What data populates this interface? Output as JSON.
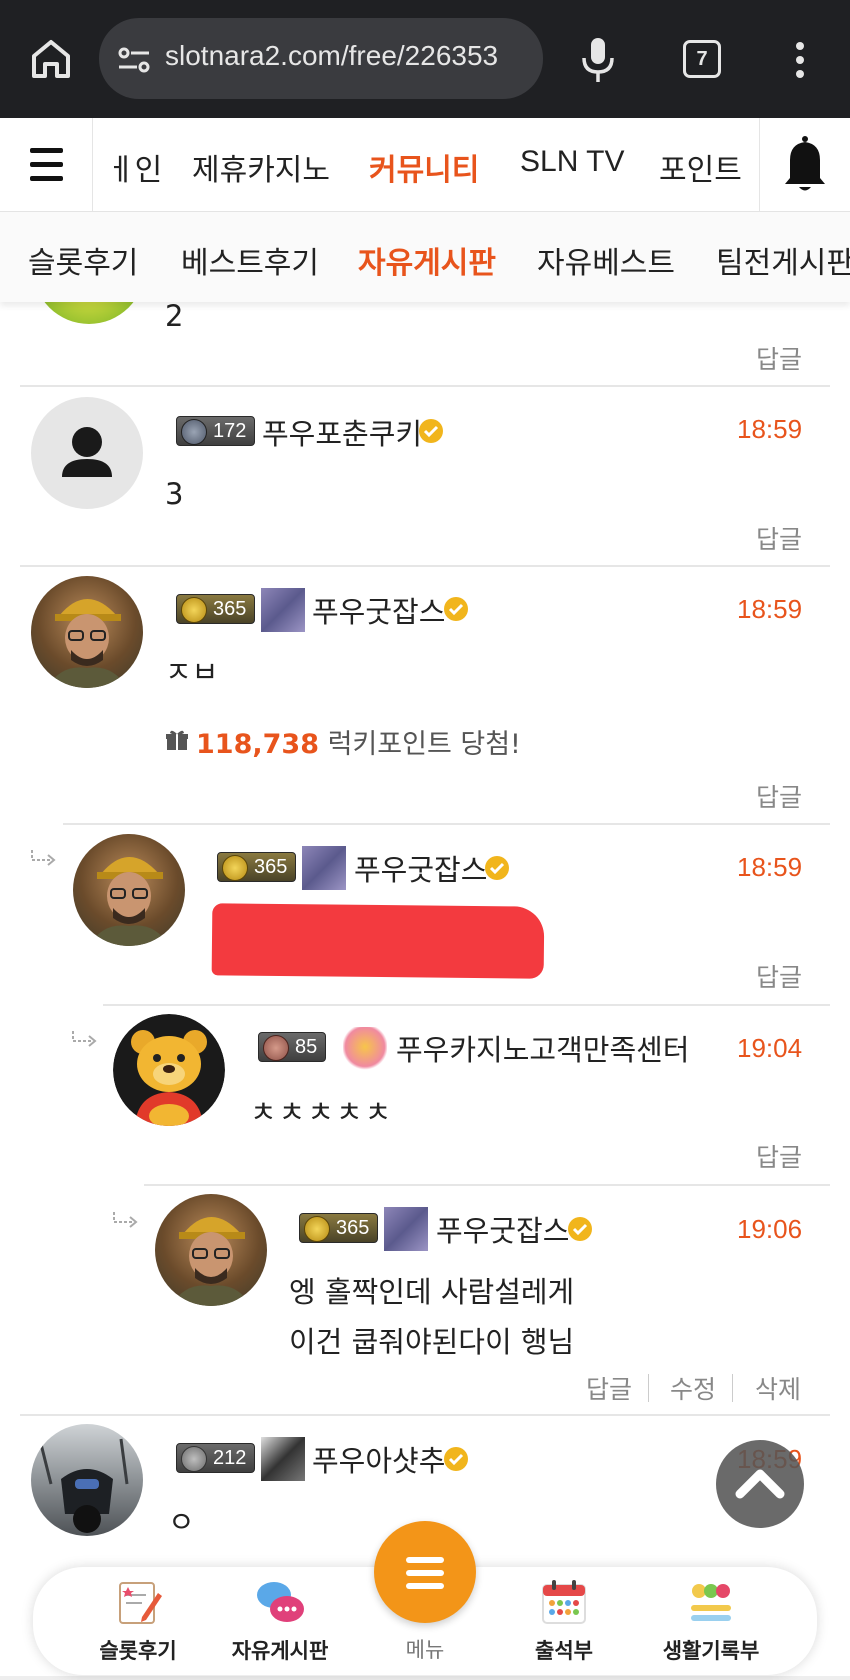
{
  "browser": {
    "url": "slotnara2.com/free/226353",
    "tab_count": "7"
  },
  "main_nav": {
    "items": [
      "메인",
      "제휴카지노",
      "커뮤니티",
      "SLN TV",
      "포인트"
    ],
    "partial_first": "ㅔ인"
  },
  "sub_nav": {
    "items": [
      "슬롯후기",
      "베스트후기",
      "자유게시판",
      "자유베스트",
      "팀전게시판"
    ]
  },
  "comments": [
    {
      "body": "2",
      "reply": "답글"
    },
    {
      "level": "172",
      "nick": "푸우포춘쿠키",
      "time": "18:59",
      "body": "3",
      "reply": "답글"
    },
    {
      "level": "365",
      "nick": "푸우굿잡스",
      "time": "18:59",
      "body": "ㅈㅂ",
      "lucky_points": "118,738",
      "lucky_text": "럭키포인트 당첨!",
      "reply": "답글"
    },
    {
      "level": "365",
      "nick": "푸우굿잡스",
      "time": "18:59",
      "reply": "답글"
    },
    {
      "level": "85",
      "nick": "푸우카지노고객만족센터",
      "time": "19:04",
      "body": "ㅊㅊㅊㅊㅊ",
      "reply": "답글"
    },
    {
      "level": "365",
      "nick": "푸우굿잡스",
      "time": "19:06",
      "body_line1": "엥 홀짝인데 사람설레게",
      "body_line2": "이건 쿱줘야된다이 행님",
      "reply": "답글",
      "edit": "수정",
      "delete": "삭제"
    },
    {
      "level": "212",
      "nick": "푸우아샷추",
      "time": "18:59",
      "body": "ㅇ"
    }
  ],
  "bottom_bar": {
    "items": [
      "슬롯후기",
      "자유게시판",
      "출석부",
      "생활기록부"
    ],
    "menu_label": "메뉴"
  },
  "colors": {
    "accent": "#e8541c",
    "fab": "#f39518",
    "browser_bg": "#1f2023"
  }
}
